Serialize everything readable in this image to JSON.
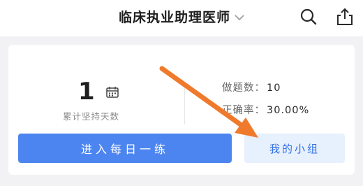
{
  "header": {
    "title": "临床执业助理医师",
    "icons": [
      "chevron-down-icon",
      "search-icon",
      "share-icon"
    ]
  },
  "stats": {
    "streak_value": "1",
    "streak_label": "累计坚持天数",
    "questions_label": "做题数：",
    "questions_value": "10",
    "accuracy_label": "正确率：",
    "accuracy_value": "30.00%"
  },
  "actions": {
    "daily_practice_label": "进入每日一练",
    "my_group_label": "我的小组"
  },
  "colors": {
    "primary_button": "#4d85f0",
    "secondary_button": "#e7f0fd",
    "secondary_text": "#2f6fe8",
    "annotation_arrow": "#f07a2c"
  }
}
